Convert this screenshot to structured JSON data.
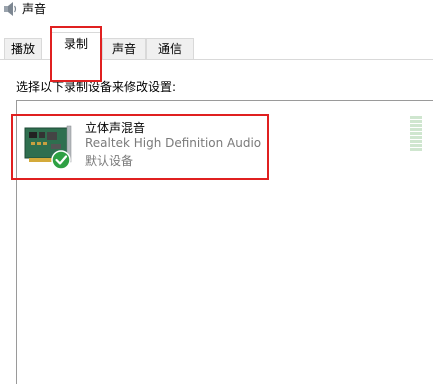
{
  "window": {
    "title": "声音",
    "title_icon": "speaker-icon"
  },
  "tabs": [
    {
      "label": "播放",
      "active": false
    },
    {
      "label": "录制",
      "active": true
    },
    {
      "label": "声音",
      "active": false
    },
    {
      "label": "通信",
      "active": false
    }
  ],
  "recording": {
    "instructions": "选择以下录制设备来修改设置:",
    "devices": [
      {
        "name": "立体声混音",
        "driver": "Realtek High Definition Audio",
        "status": "默认设备",
        "icon": "sound-card-icon",
        "badge_icon": "green-check-icon",
        "level": 0
      }
    ]
  },
  "colors": {
    "highlight_box": "#e02020",
    "check_badge": "#2ea043",
    "meter_bar": "#cfe6cf"
  }
}
